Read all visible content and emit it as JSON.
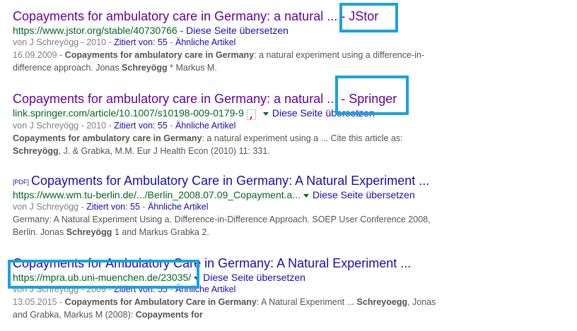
{
  "results": [
    {
      "title": "Copayments for ambulatory care in Germany: a natural ... - JStor",
      "url": "https://www.jstor.org/stable/40730766",
      "url_sep": " - ",
      "translate": "Diese Seite übersetzen",
      "meta_prefix": "von J Schreyögg - 2010 - ",
      "cited": "Zitiert von: 55",
      "similar": "Ähnliche Artikel",
      "date": "16.09.2009 - ",
      "snippet_b1": "Copayments for ambulatory care in Germany",
      "snippet_t1": ": a natural experiment using a difference-in-difference approach. Jonas ",
      "snippet_b2": "Schreyögg",
      "snippet_t2": " * Markus M."
    },
    {
      "title": "Copayments for ambulatory care in Germany: a natural ... - Springer",
      "url": "link.springer.com/article/10.1007/s10198-009-0179-9",
      "translate": "Diese Seite übersetzen",
      "meta_prefix": "von J Schreyögg - 2010 - ",
      "cited": "Zitiert von: 55",
      "similar": "Ähnliche Artikel",
      "snippet_b1": "Copayments for ambulatory care in Germany",
      "snippet_t1": ": a natural experiment using a ... Cite this article as: ",
      "snippet_b2": "Schreyögg",
      "snippet_t2": ", J. & Grabka, M.M. Eur J Health Econ (2010) 11: 331."
    },
    {
      "pdf": "[PDF]",
      "title": "Copayments for Ambulatory Care in Germany: A Natural Experiment ...",
      "url": "https://www.wm.tu-berlin.de/.../Berlin_2008.07.09_Copayment.a...",
      "translate": "Diese Seite übersetzen",
      "meta_prefix": "von J Schreyögg - ",
      "cited": "Zitiert von: 55",
      "similar": "Ähnliche Artikel",
      "snippet_t0": "Germany: A Natural Experiment Using a. Difference-in-Difference Approach. SOEP User Conference 2008, Berlin. Jonas ",
      "snippet_b1": "Schreyögg",
      "snippet_t1": " 1 and Markus Grabka 2."
    },
    {
      "title": "Copayments for Ambulatory Care in Germany: A Natural Experiment ...",
      "url": "https://mpra.ub.uni-muenchen.de/23035/",
      "translate": "Diese Seite übersetzen",
      "meta_prefix": "von J Schreyögg - 2009 - ",
      "cited": "Zitiert von: 55",
      "similar": "Ähnliche Artikel",
      "date": "13.05.2015 - ",
      "snippet_b1": "Copayments for Ambulatory Care in Germany",
      "snippet_t1": ": A Natural Experiment ... ",
      "snippet_b2": "Schreyoegg",
      "snippet_t2": ", Jonas and Grabka, Markus M (2008): ",
      "snippet_b3": "Copayments for"
    }
  ],
  "colors": {
    "highlight_box": "#1ba1e2",
    "title_visited": "#660099",
    "title_link": "#1a0dab",
    "url_green": "#006621"
  },
  "icons": {
    "citation": "quote-icon",
    "dropdown": "chevron-down-icon"
  }
}
